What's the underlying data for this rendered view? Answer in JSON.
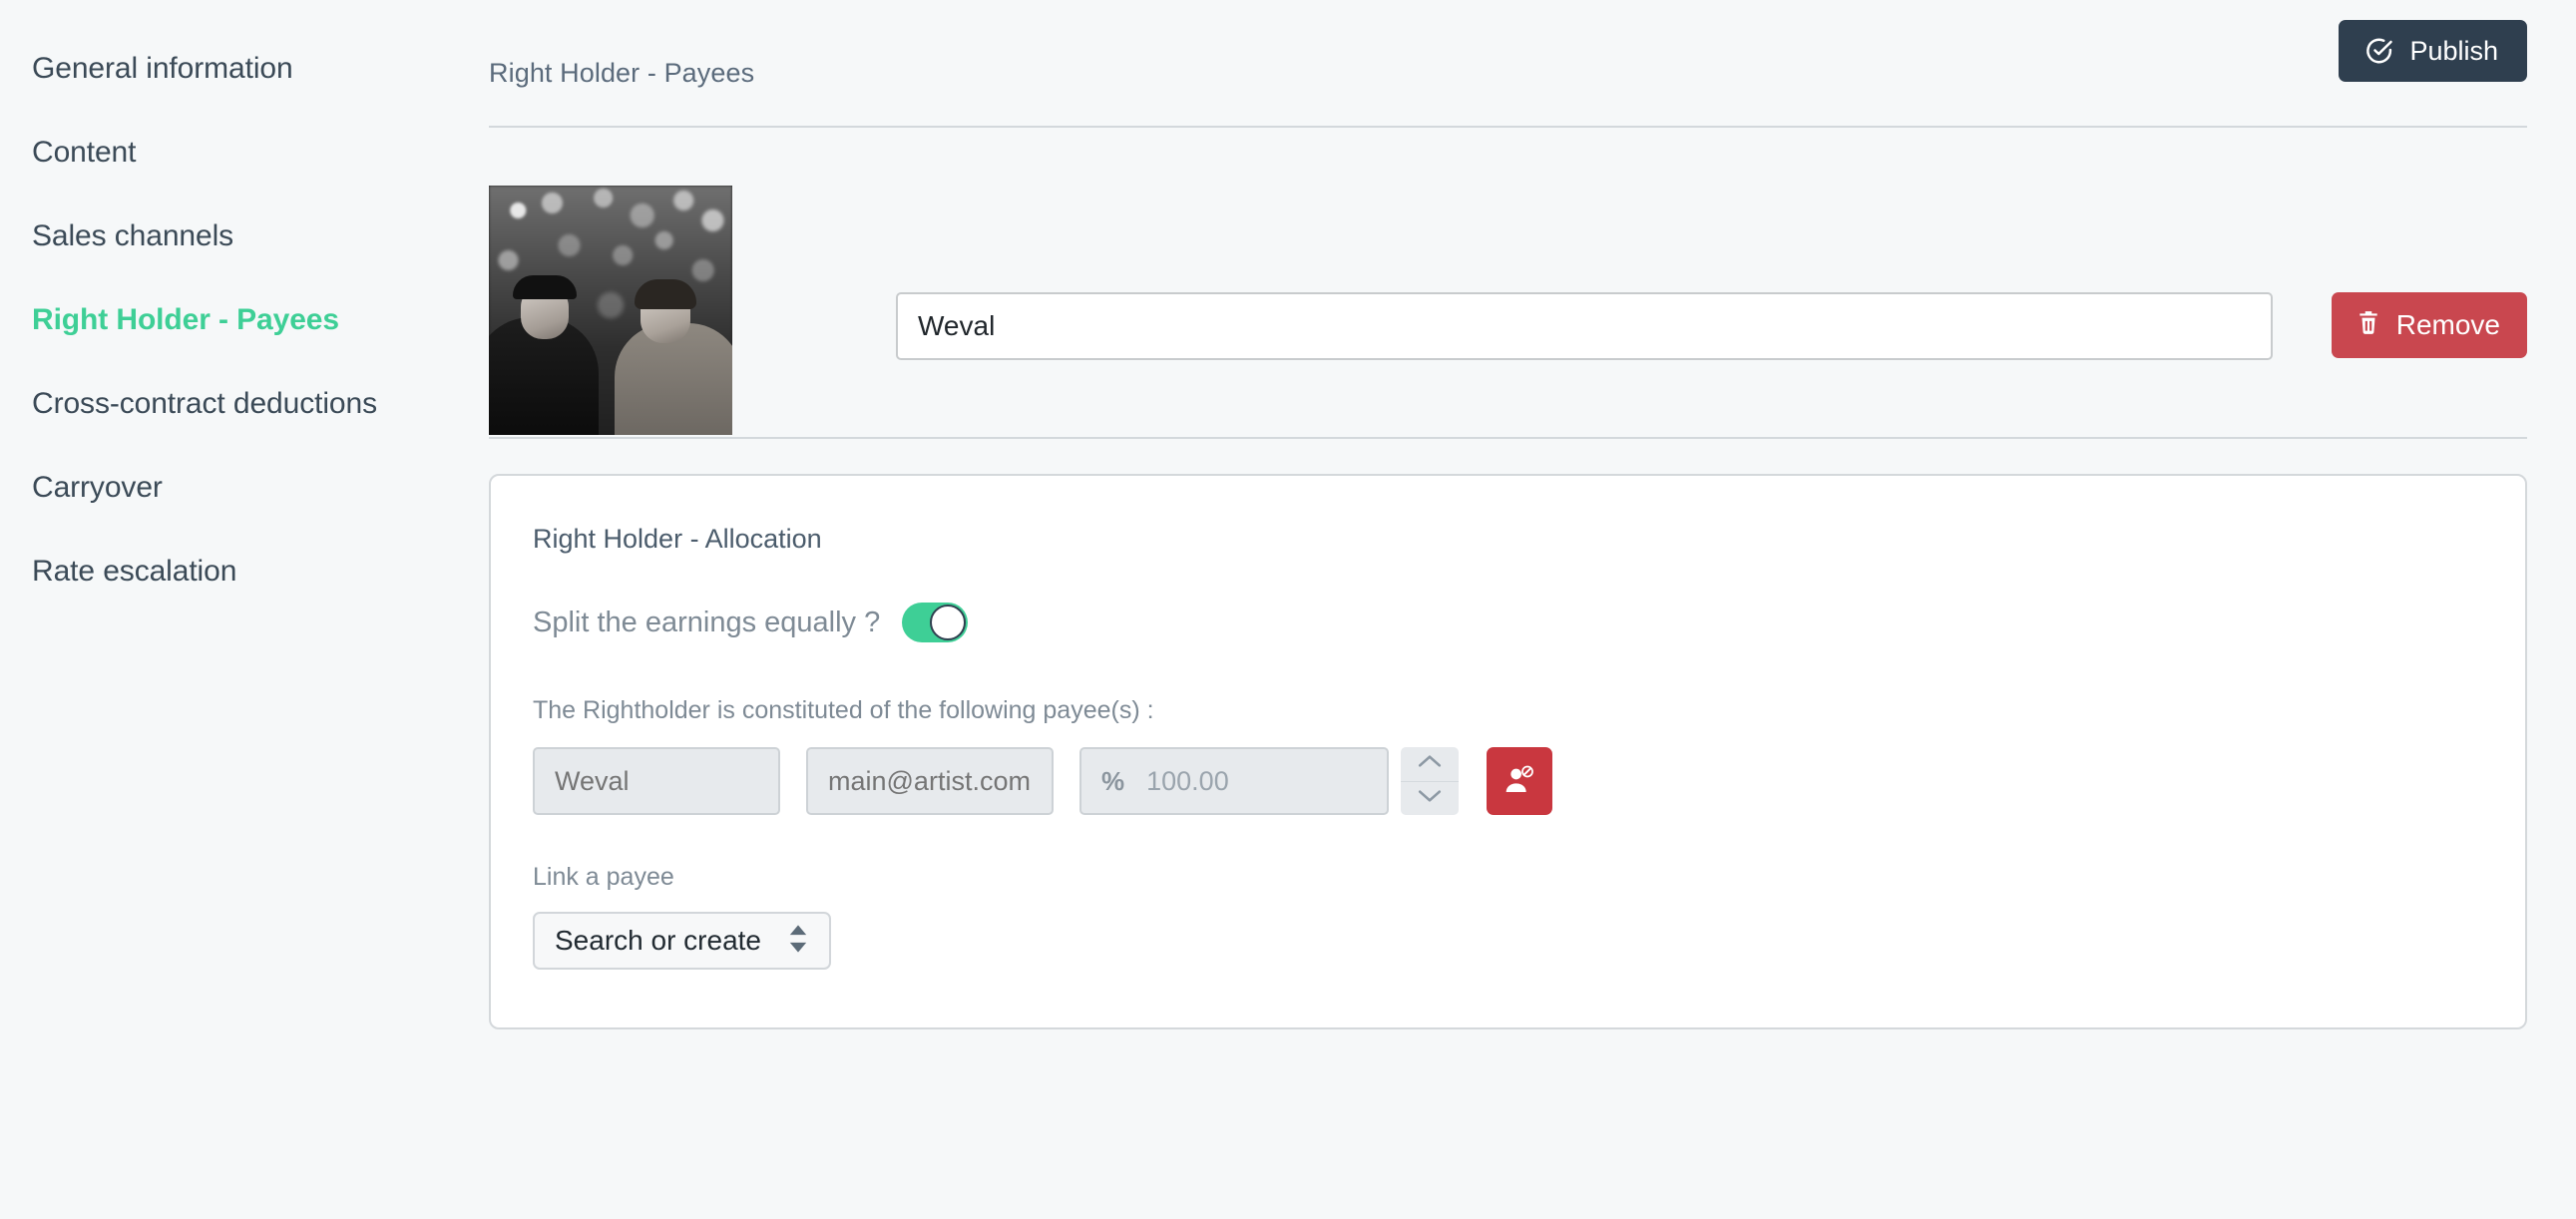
{
  "sidebar": {
    "items": [
      {
        "label": "General information",
        "active": false
      },
      {
        "label": "Content",
        "active": false
      },
      {
        "label": "Sales channels",
        "active": false
      },
      {
        "label": "Right Holder - Payees",
        "active": true
      },
      {
        "label": "Cross-contract deductions",
        "active": false
      },
      {
        "label": "Carryover",
        "active": false
      },
      {
        "label": "Rate escalation",
        "active": false
      }
    ]
  },
  "header": {
    "title": "Right Holder - Payees",
    "publish_label": "Publish",
    "publish_icon": "check-circle-icon",
    "publish_color": "#2f3f4f"
  },
  "holder": {
    "photo_alt": "artist-photo",
    "name_value": "Weval",
    "remove_label": "Remove",
    "remove_icon": "trash-icon",
    "remove_color": "#c9474f"
  },
  "allocation": {
    "title": "Right Holder - Allocation",
    "split_label": "Split the earnings equally ?",
    "split_enabled": true,
    "toggle_color": "#3ecf96",
    "payees_label": "The Rightholder is constituted of the following payee(s) :",
    "payee_rows": [
      {
        "name_placeholder": "Weval",
        "email_placeholder": "main@artist.com",
        "percent_sign": "%",
        "percent_value": "100.00",
        "unlink_icon": "user-block-icon",
        "unlink_color": "#c9373f"
      }
    ],
    "link_label": "Link a payee",
    "link_select_value": "Search or create",
    "link_select_icon": "chevron-up-down-icon"
  },
  "theme": {
    "accent_green": "#3ecf96",
    "page_bg": "#f6f8f9",
    "text_dark": "#3b4a57",
    "text_muted": "#7e8a95"
  }
}
